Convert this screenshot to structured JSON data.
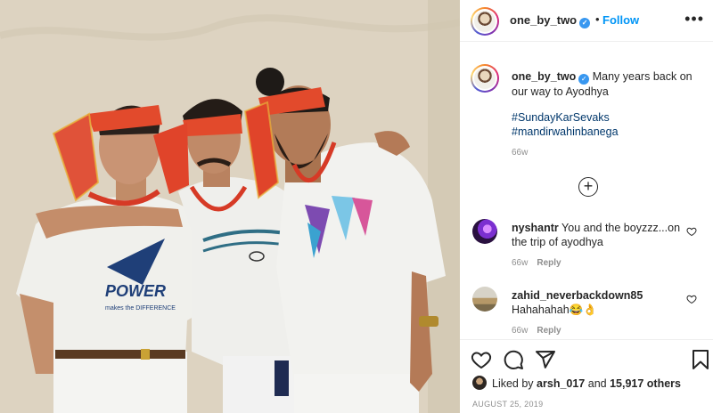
{
  "header": {
    "username": "one_by_two",
    "separator": "•",
    "follow_label": "Follow",
    "more_label": "•••"
  },
  "caption": {
    "username": "one_by_two",
    "text": "Many years back on our way to Ayodhya",
    "hashtags": [
      "#SundayKarSevaks",
      "#mandirwahinbanega"
    ],
    "time": "66w"
  },
  "load_more_label": "+",
  "comments": [
    {
      "username": "nyshantr",
      "text": "You and the boyzzz...on the trip of ayodhya",
      "time": "66w",
      "reply_label": "Reply"
    },
    {
      "username": "zahid_neverbackdown85",
      "text": "Hahahahah😂👌",
      "time": "66w",
      "reply_label": "Reply"
    }
  ],
  "icons": {
    "like": "heart-icon",
    "comment": "comment-icon",
    "share": "share-icon",
    "save": "bookmark-icon",
    "more": "more-options-icon",
    "load_more": "plus-circle-icon",
    "verified": "verified-badge-icon"
  },
  "likes": {
    "prefix": "Liked by",
    "user": "arsh_017",
    "connector": "and",
    "count": "15,917 others"
  },
  "date": "AUGUST 25, 2019",
  "photo": {
    "shirt_text_left": "POWER",
    "shirt_subtext_left": "makes the DIFFERENCE"
  },
  "colors": {
    "accent": "#0095f6",
    "hashtag": "#00376b",
    "muted": "#8e8e8e",
    "headband": "#e0442a"
  }
}
